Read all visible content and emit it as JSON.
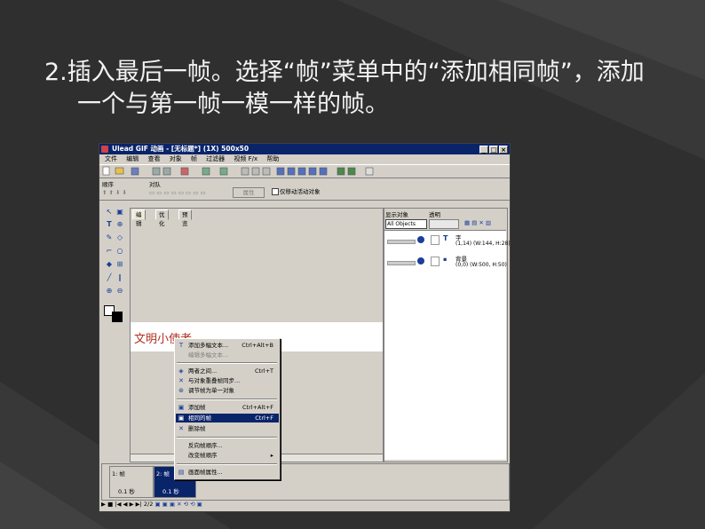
{
  "slide": {
    "heading_line1": "2.插入最后一帧。选择“帧”菜单中的“添加相同帧”，添加",
    "heading_line2": "一个与第一帧一模一样的帧。",
    "colors": {
      "background": "#2f2f2f",
      "text": "#f2f2f2"
    }
  },
  "window": {
    "title": "Ulead GIF 动画 - [无标题*] (1X) 500x50",
    "controls": [
      "_",
      "□",
      "×"
    ],
    "menu": [
      "文件",
      "编辑",
      "查看",
      "对象",
      "帧",
      "过滤器",
      "视频 F/x",
      "帮助"
    ],
    "panel_labels": {
      "order": "顺序",
      "align": "对队",
      "properties": "属性",
      "only_move_active": "仅移动活动对象"
    },
    "tabs": [
      "编辑",
      "优化",
      "预览"
    ],
    "canvas_text": "文明小使者",
    "object_panel": {
      "show_objects_label": "显示对象",
      "opacity_label": "透明",
      "filter_value": "All Objects",
      "objects": [
        {
          "name": "字",
          "info": "(1,14) (W:144, H:28)"
        },
        {
          "name": "背景",
          "info": "(0,0) (W:500, H:50)"
        }
      ]
    },
    "frames": [
      {
        "number": "1: 帧",
        "duration": "0.1 秒",
        "selected": false
      },
      {
        "number": "2: 帧",
        "duration": "0.1 秒",
        "selected": true
      }
    ],
    "status_page": "2/2"
  },
  "context_menu": {
    "items": [
      {
        "label": "添加多幅文本...",
        "shortcut": "Ctrl+Alt+B",
        "icon": "add-text-icon",
        "disabled": false,
        "highlighted": false
      },
      {
        "label": "编辑多幅文本...",
        "shortcut": "",
        "icon": "",
        "disabled": true,
        "highlighted": false
      },
      {
        "label": "两者之间...",
        "shortcut": "Ctrl+T",
        "icon": "tween-icon",
        "disabled": false,
        "highlighted": false
      },
      {
        "label": "与对象重叠帧同步...",
        "shortcut": "",
        "icon": "sync-icon",
        "disabled": false,
        "highlighted": false
      },
      {
        "label": "调节帧为单一对象",
        "shortcut": "",
        "icon": "merge-icon",
        "disabled": false,
        "highlighted": false
      },
      {
        "label": "添加帧",
        "shortcut": "Ctrl+Alt+F",
        "icon": "add-frame-icon",
        "disabled": false,
        "highlighted": false
      },
      {
        "label": "相同的帧",
        "shortcut": "Ctrl+F",
        "icon": "duplicate-frame-icon",
        "disabled": false,
        "highlighted": true
      },
      {
        "label": "删除帧",
        "shortcut": "",
        "icon": "delete-frame-icon",
        "disabled": false,
        "highlighted": false
      },
      {
        "label": "反向帧顺序...",
        "shortcut": "",
        "icon": "",
        "disabled": false,
        "highlighted": false
      },
      {
        "label": "改变帧顺序",
        "shortcut": "▸",
        "icon": "",
        "disabled": false,
        "highlighted": false
      },
      {
        "label": "画面帧属性...",
        "shortcut": "",
        "icon": "frame-properties-icon",
        "disabled": false,
        "highlighted": false
      }
    ]
  }
}
